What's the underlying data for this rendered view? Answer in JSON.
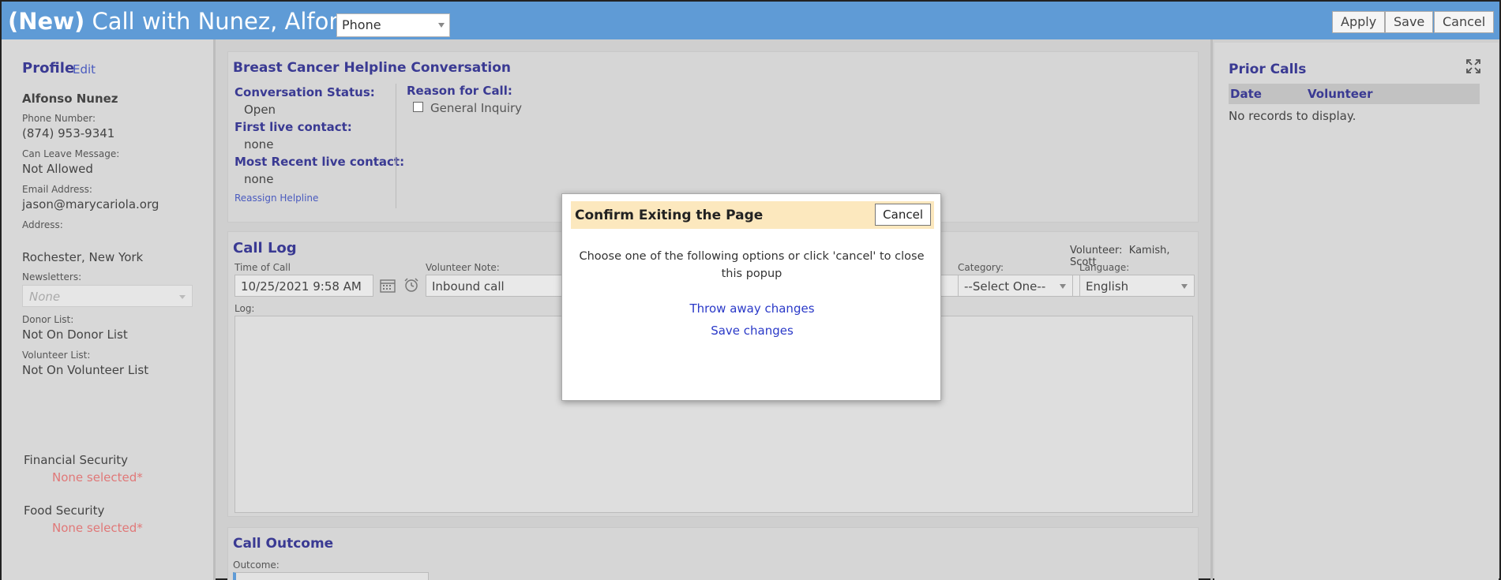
{
  "header": {
    "title_prefix": "(New)",
    "title": " Call with Nunez, Alfonso",
    "call_type": "Phone",
    "buttons": {
      "apply": "Apply",
      "save": "Save",
      "cancel": "Cancel"
    }
  },
  "profile": {
    "heading": "Profile",
    "edit": "Edit",
    "name": "Alfonso Nunez",
    "phone_label": "Phone Number:",
    "phone": "(874) 953-9341",
    "leave_msg_label": "Can Leave Message:",
    "leave_msg": "Not Allowed",
    "email_label": "Email Address:",
    "email": "jason@marycariola.org",
    "address_label": "Address:",
    "address": "Rochester, New York",
    "newsletters_label": "Newsletters:",
    "newsletters": "None",
    "donor_label": "Donor List:",
    "donor": "Not On Donor List",
    "volunteer_label": "Volunteer List:",
    "volunteer": "Not On Volunteer List",
    "financial": "Financial Security",
    "financial_val": "None selected*",
    "food": "Food Security",
    "food_val": "None selected*"
  },
  "conversation": {
    "title": "Breast Cancer Helpline Conversation",
    "status_label": "Conversation Status:",
    "status": "Open",
    "first_label": "First live contact:",
    "first": "none",
    "recent_label": "Most Recent live contact:",
    "recent": "none",
    "reassign": "Reassign Helpline",
    "reason_label": "Reason for Call:",
    "reason_option": "General Inquiry"
  },
  "call_log": {
    "title": "Call Log",
    "volunteer_label": "Volunteer:",
    "volunteer": "Kamish, Scott",
    "time_label": "Time of Call",
    "time": "10/25/2021 9:58 AM",
    "note_label": "Volunteer Note:",
    "note": "Inbound call",
    "category_label": "Category:",
    "category": "--Select One--",
    "language_label": "Language:",
    "language": "English",
    "log_label": "Log:"
  },
  "outcome": {
    "title": "Call Outcome",
    "outcome_label": "Outcome:"
  },
  "prior_calls": {
    "title": "Prior Calls",
    "col_date": "Date",
    "col_volunteer": "Volunteer",
    "empty": "No records to display."
  },
  "modal": {
    "title": "Confirm Exiting the Page",
    "cancel": "Cancel",
    "message": "Choose one of the following options or click 'cancel' to close this popup",
    "throw_away": "Throw away changes",
    "save": "Save changes"
  }
}
